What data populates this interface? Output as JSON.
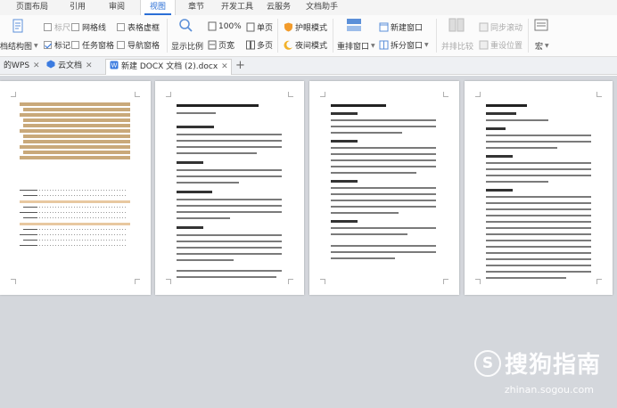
{
  "menu": {
    "tabs": [
      "页面布局",
      "引用",
      "审阅",
      "视图",
      "章节",
      "开发工具",
      "云服务",
      "文档助手"
    ],
    "active": "视图"
  },
  "ribbon": {
    "outline": "档结构图",
    "ruler": "标尺",
    "gridlines": "网格线",
    "table_border": "表格虚框",
    "markup": "标记",
    "task_pane": "任务窗格",
    "nav_pane": "导航窗格",
    "show_ratio": "显示比例",
    "zoom": "100%",
    "page_width": "页宽",
    "single_page": "单页",
    "multi_page": "多页",
    "eye_care": "护眼模式",
    "night_mode": "夜间模式",
    "arrange": "重排窗口",
    "new_window": "新建窗口",
    "split_window": "拆分窗口",
    "side_by_side": "并排比较",
    "sync_scroll": "同步滚动",
    "reset_position": "重设位置",
    "macro": "宏"
  },
  "doctabs": [
    {
      "label": "的WPS",
      "closable": true
    },
    {
      "label": "云文档",
      "closable": true
    },
    {
      "label": "新建 DOCX 文档 (2).docx",
      "closable": true
    }
  ],
  "watermark": {
    "logo_letter": "S",
    "brand": "搜狗指南",
    "url": "zhinan.sogou.com"
  }
}
